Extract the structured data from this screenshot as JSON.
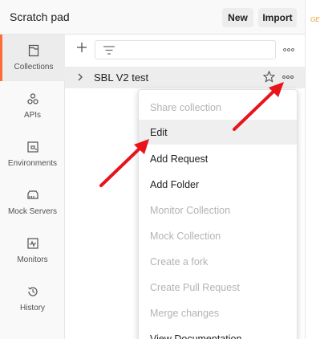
{
  "header": {
    "workspace_title": "Scratch pad",
    "new_label": "New",
    "import_label": "Import",
    "edge_fragment": "GE"
  },
  "sidebar": {
    "items": [
      {
        "label": "Collections",
        "icon": "collections-icon",
        "active": true
      },
      {
        "label": "APIs",
        "icon": "apis-icon",
        "active": false
      },
      {
        "label": "Environments",
        "icon": "environments-icon",
        "active": false
      },
      {
        "label": "Mock Servers",
        "icon": "mock-servers-icon",
        "active": false
      },
      {
        "label": "Monitors",
        "icon": "monitors-icon",
        "active": false
      },
      {
        "label": "History",
        "icon": "history-icon",
        "active": false
      }
    ]
  },
  "collections": {
    "items": [
      {
        "name": "SBL V2 test"
      }
    ]
  },
  "context_menu": {
    "items": [
      {
        "label": "Share collection",
        "enabled": false
      },
      {
        "label": "Edit",
        "enabled": true,
        "highlighted": true
      },
      {
        "label": "Add Request",
        "enabled": true
      },
      {
        "label": "Add Folder",
        "enabled": true
      },
      {
        "label": "Monitor Collection",
        "enabled": false
      },
      {
        "label": "Mock Collection",
        "enabled": false
      },
      {
        "label": "Create a fork",
        "enabled": false
      },
      {
        "label": "Create Pull Request",
        "enabled": false
      },
      {
        "label": "Merge changes",
        "enabled": false
      },
      {
        "label": "View Documentation",
        "enabled": true
      }
    ]
  },
  "colors": {
    "accent": "#ff6c37",
    "annotation_arrow": "#e8141c",
    "disabled_text": "#b3b3b3"
  }
}
